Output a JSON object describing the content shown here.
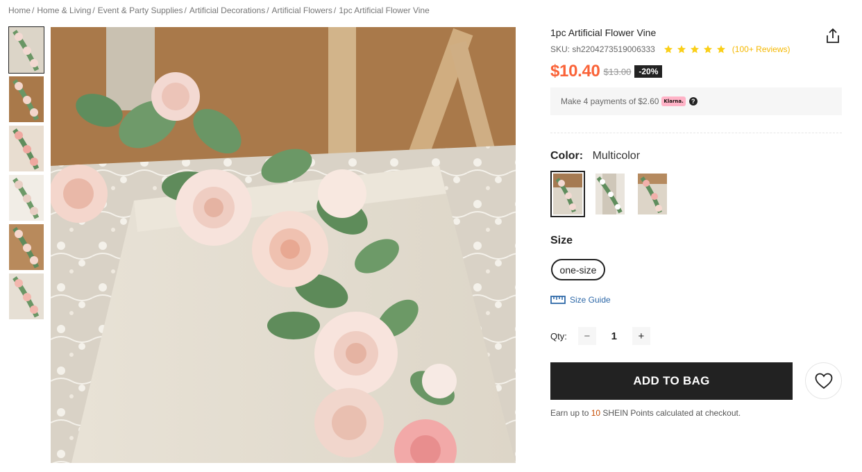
{
  "breadcrumb": [
    {
      "label": "Home",
      "sep": "/"
    },
    {
      "label": "Home & Living",
      "sep": "/"
    },
    {
      "label": "Event & Party Supplies",
      "sep": "/"
    },
    {
      "label": "Artificial Decorations",
      "sep": "/"
    },
    {
      "label": "Artificial Flowers",
      "sep": "/"
    },
    {
      "label": "1pc Artificial Flower Vine",
      "sep": ""
    }
  ],
  "product": {
    "title": "1pc Artificial Flower Vine",
    "sku": "SKU: sh2204273519006333",
    "rating": 5,
    "reviews": "(100+ Reviews)",
    "price": "$10.40",
    "old_price": "$13.00",
    "discount": "-20%"
  },
  "klarna": {
    "text": "Make 4 payments of $2.60",
    "badge": "Klarna.",
    "help": "?"
  },
  "color": {
    "label": "Color:",
    "value": "Multicolor",
    "swatch_count": 3
  },
  "size": {
    "label": "Size",
    "options": [
      "one-size"
    ],
    "guide_label": "Size Guide"
  },
  "qty": {
    "label": "Qty:",
    "minus": "−",
    "value": "1",
    "plus": "+"
  },
  "actions": {
    "add_to_bag": "ADD TO BAG"
  },
  "points": {
    "prefix": "Earn up to",
    "value": "10",
    "suffix": "SHEIN Points calculated at checkout."
  },
  "colors": {
    "price": "#fa6338",
    "star": "#facf19",
    "link": "#2d68a8",
    "button": "#222222"
  },
  "icons": {
    "share": "share-icon",
    "heart": "heart-icon",
    "ruler": "ruler-icon",
    "star": "star-icon"
  }
}
